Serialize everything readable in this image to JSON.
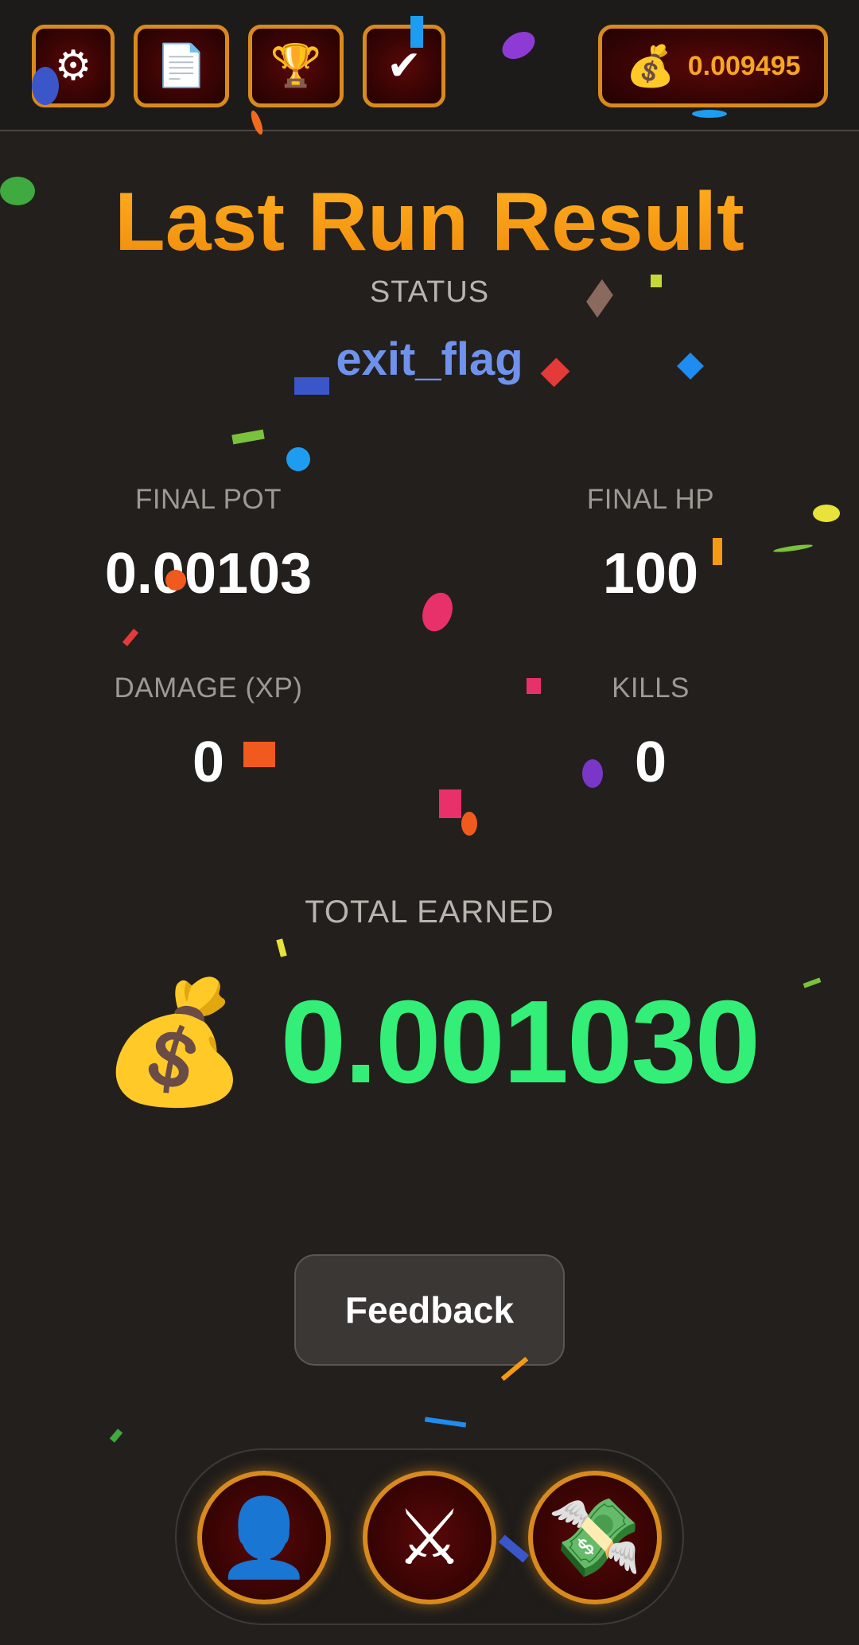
{
  "topbar": {
    "buttons": [
      {
        "name": "settings",
        "glyph": "⚙"
      },
      {
        "name": "report",
        "glyph": "📄"
      },
      {
        "name": "leaderboard",
        "glyph": "🏆"
      },
      {
        "name": "tasks",
        "glyph": "✔"
      }
    ],
    "balance": {
      "icon": "💰",
      "amount": "0.009495"
    }
  },
  "result": {
    "title": "Last Run Result",
    "status_label": "STATUS",
    "status_value": "exit_flag",
    "stats": {
      "final_pot": {
        "label": "FINAL POT",
        "value": "0.00103"
      },
      "final_hp": {
        "label": "FINAL HP",
        "value": "100"
      },
      "damage": {
        "label": "DAMAGE (XP)",
        "value": "0"
      },
      "kills": {
        "label": "KILLS",
        "value": "0"
      }
    },
    "total_label": "TOTAL EARNED",
    "total_icon": "💰",
    "total_value": "0.001030"
  },
  "feedback_label": "Feedback",
  "bottom_nav": [
    {
      "name": "profile",
      "glyph": "👤"
    },
    {
      "name": "battle",
      "glyph": "⚔"
    },
    {
      "name": "cashout",
      "glyph": "💸"
    }
  ],
  "colors": {
    "accent": "#d98a1c",
    "title": "#f59a12",
    "status": "#6f92ec",
    "earned": "#33ee77",
    "background": "#231f1c"
  }
}
